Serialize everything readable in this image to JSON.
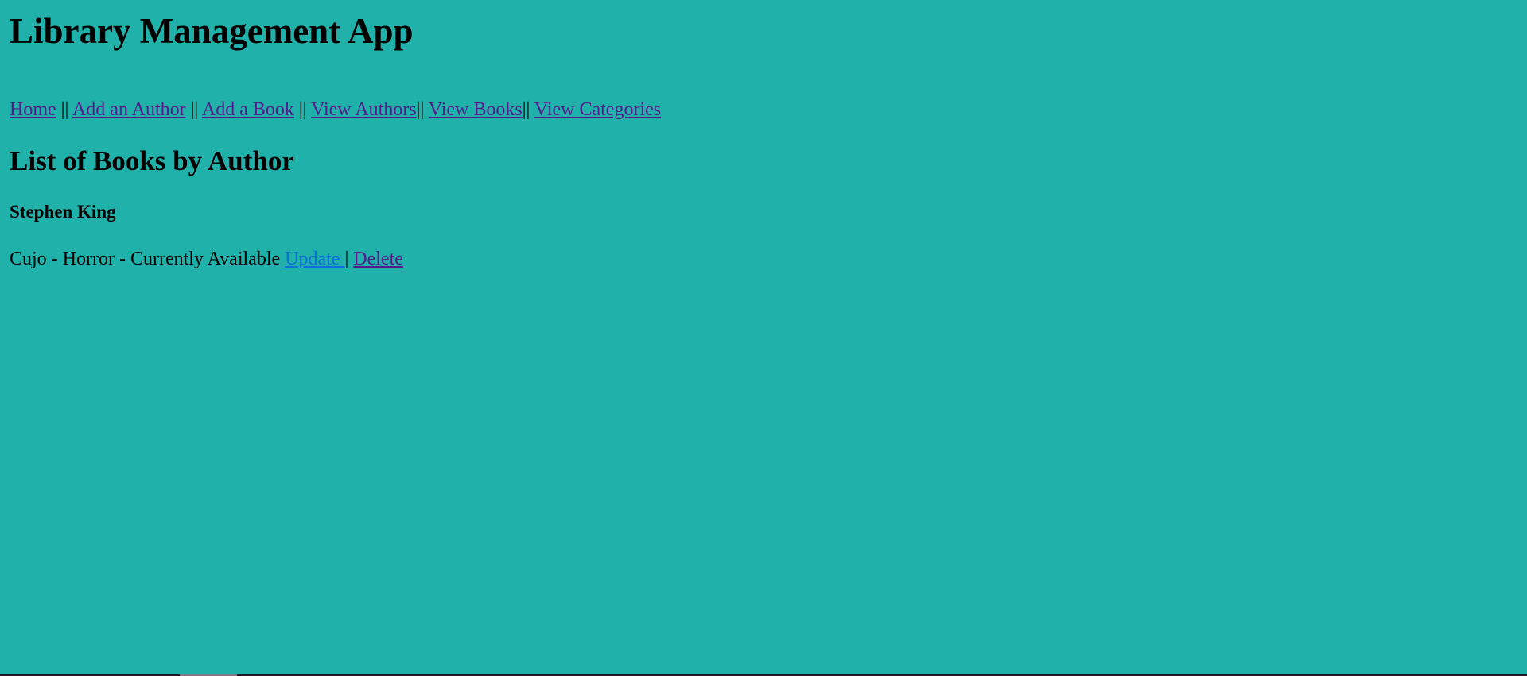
{
  "app": {
    "title": "Library Management App"
  },
  "nav": {
    "items": [
      {
        "label": "Home"
      },
      {
        "label": "Add an Author"
      },
      {
        "label": "Add a Book"
      },
      {
        "label": "View Authors"
      },
      {
        "label": "View Books"
      },
      {
        "label": "View Categories"
      }
    ],
    "separators": [
      " || ",
      " || ",
      " || ",
      "|| ",
      "|| "
    ]
  },
  "main": {
    "section_title": "List of Books by Author",
    "author": "Stephen King",
    "books": [
      {
        "description": "Cujo - Horror - Currently Available",
        "update_label": "Update",
        "action_separator": "|",
        "delete_label": "Delete"
      }
    ]
  },
  "colors": {
    "background": "#20b2aa",
    "visited_link": "#551a8b",
    "active_link": "#0e6fd6"
  }
}
